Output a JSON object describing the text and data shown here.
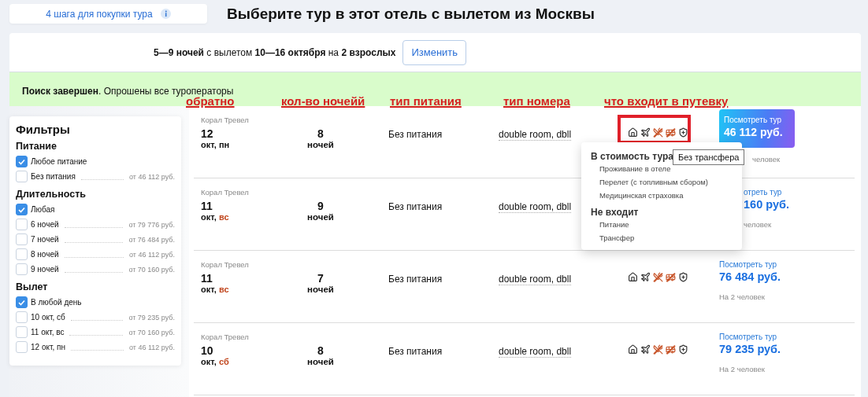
{
  "steps_link": {
    "label": "4 шага для покупки тура"
  },
  "title": "Выберите тур в этот отель с вылетом из Москвы",
  "search_summary": {
    "text": "**5—9 ночей** с вылетом **10—16 октября** на **2 взрослых**",
    "button": "Изменить"
  },
  "status_banner": {
    "text": "**Поиск завершен**. Опрошены все туроператоры"
  },
  "annotations": [
    {
      "label": "обратно"
    },
    {
      "label": "кол-во ночейй"
    },
    {
      "label": "тип питания"
    },
    {
      "label": "тип номера"
    },
    {
      "label": "что входит в путевку"
    }
  ],
  "filters": {
    "title": "Фильтры",
    "groups": [
      {
        "title": "Питание",
        "options": [
          {
            "label": "Любое питание",
            "checked": true
          },
          {
            "label": "Без питания",
            "price": "от 46 112 руб.",
            "checked": false
          }
        ]
      },
      {
        "title": "Длительность",
        "options": [
          {
            "label": "Любая",
            "checked": true
          },
          {
            "label": "6 ночей",
            "price": "от 79 776 руб.",
            "checked": false
          },
          {
            "label": "7 ночей",
            "price": "от 76 484 руб.",
            "checked": false
          },
          {
            "label": "8 ночей",
            "price": "от 46 112 руб.",
            "checked": false
          },
          {
            "label": "9 ночей",
            "price": "от 70 160 руб.",
            "checked": false
          }
        ]
      },
      {
        "title": "Вылет",
        "options": [
          {
            "label": "В любой день",
            "checked": true
          },
          {
            "label": "10 окт, сб",
            "price": "от 79 235 руб.",
            "checked": false
          },
          {
            "label": "11 окт, вс",
            "price": "от 70 160 руб.",
            "checked": false
          },
          {
            "label": "12 окт, пн",
            "price": "от 46 112 руб.",
            "checked": false
          }
        ]
      }
    ]
  },
  "tours": [
    {
      "operator": "Корал Тревел",
      "day": "12",
      "month": "окт,",
      "weekday": "пн",
      "weekend": false,
      "nights": "8",
      "nights_label": "ночей",
      "meal": "Без питания",
      "room": "double room, dbll",
      "marked": true,
      "services": [
        {
          "kind": "hotel",
          "included": true
        },
        {
          "kind": "flight",
          "included": true
        },
        {
          "kind": "meal",
          "included": false
        },
        {
          "kind": "transfer",
          "included": false
        },
        {
          "kind": "insurance",
          "included": true
        }
      ],
      "action": {
        "kind": "highlighted",
        "label": "Посмотреть тур",
        "price": "46 112 руб."
      },
      "caption": "человек",
      "covered": true
    },
    {
      "operator": "Корал Тревел",
      "day": "11",
      "month": "окт,",
      "weekday": "вс",
      "weekend": true,
      "nights": "9",
      "nights_label": "ночей",
      "meal": "Без питания",
      "room": "double room, dbll",
      "marked": false,
      "action": {
        "kind": "plain",
        "label": "отреть тур",
        "price": "160 руб."
      },
      "caption": "человек",
      "covered": true
    },
    {
      "operator": "Корал Тревел",
      "day": "11",
      "month": "окт,",
      "weekday": "вс",
      "weekend": true,
      "nights": "7",
      "nights_label": "ночей",
      "meal": "Без питания",
      "room": "double room, dbll",
      "marked": false,
      "services": [
        {
          "kind": "hotel",
          "included": true
        },
        {
          "kind": "flight",
          "included": true
        },
        {
          "kind": "meal",
          "included": false
        },
        {
          "kind": "transfer",
          "included": false
        },
        {
          "kind": "insurance",
          "included": true
        }
      ],
      "action": {
        "kind": "plain",
        "label": "Посмотреть тур",
        "price": "76 484 руб."
      },
      "caption": "На 2 человек",
      "covered": false
    },
    {
      "operator": "Корал Тревел",
      "day": "10",
      "month": "окт,",
      "weekday": "сб",
      "weekend": true,
      "nights": "8",
      "nights_label": "ночей",
      "meal": "Без питания",
      "room": "double room, dbll",
      "marked": false,
      "services": [
        {
          "kind": "hotel",
          "included": true
        },
        {
          "kind": "flight",
          "included": true
        },
        {
          "kind": "meal",
          "included": false
        },
        {
          "kind": "transfer",
          "included": false
        },
        {
          "kind": "insurance",
          "included": true
        }
      ],
      "action": {
        "kind": "plain",
        "label": "Посмотреть тур",
        "price": "79 235 руб."
      },
      "caption": "На 2 человек",
      "covered": false
    }
  ],
  "services_popover": {
    "sections": [
      {
        "title": "В стоимость тура",
        "items": [
          "Проживание в отеле",
          "Перелет (с топливным сбором)",
          "Медицинская страховка"
        ]
      },
      {
        "title": "Не входит",
        "items": [
          "Питание",
          "Трансфер"
        ]
      }
    ]
  },
  "tooltip": {
    "text": "Без трансфера"
  }
}
